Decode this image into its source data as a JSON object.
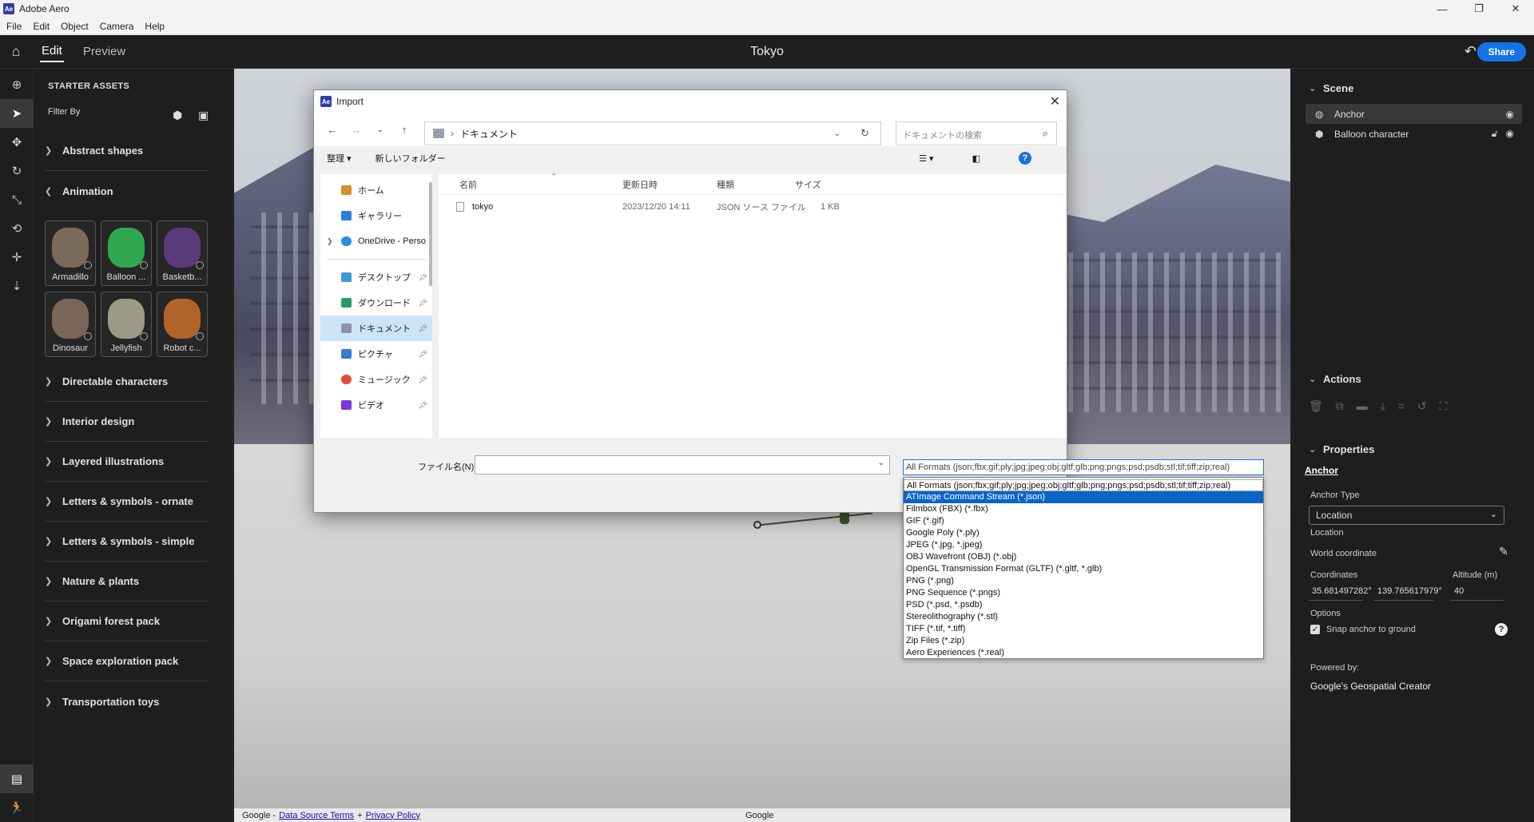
{
  "window": {
    "title": "Adobe Aero",
    "logo": "Ae",
    "controls": [
      "—",
      "❐",
      "✕"
    ]
  },
  "menu": [
    "File",
    "Edit",
    "Object",
    "Camera",
    "Help"
  ],
  "appbar": {
    "tabs": [
      "Edit",
      "Preview"
    ],
    "project_title": "Tokyo",
    "share_label": "Share"
  },
  "assets": {
    "header": "STARTER ASSETS",
    "filter_label": "Filter By",
    "categories_top": [
      "Abstract shapes",
      "Animation"
    ],
    "thumbnails": [
      {
        "label": "Armadillo",
        "color": "#7a6a5a"
      },
      {
        "label": "Balloon ...",
        "color": "#2fa84f"
      },
      {
        "label": "Basketb...",
        "color": "#5a3a7a"
      },
      {
        "label": "Dinosaur",
        "color": "#7a6658"
      },
      {
        "label": "Jellyfish",
        "color": "#9a9a86"
      },
      {
        "label": "Robot c...",
        "color": "#b0642a"
      }
    ],
    "categories": [
      "Directable characters",
      "Interior design",
      "Layered illustrations",
      "Letters & symbols - ornate",
      "Letters & symbols - simple",
      "Nature & plants",
      "Origami forest pack",
      "Space exploration pack",
      "Transportation toys"
    ]
  },
  "viewport": {
    "footer_prefix": "Google -",
    "footer_link1": "Data Source Terms",
    "footer_plus": "+",
    "footer_link2": "Privacy Policy",
    "footer_center": "Google"
  },
  "scene": {
    "title": "Scene",
    "items": [
      {
        "label": "Anchor",
        "selected": true
      },
      {
        "label": "Balloon character",
        "selected": false
      }
    ]
  },
  "actions": {
    "title": "Actions"
  },
  "properties": {
    "title": "Properties",
    "subtab": "Anchor",
    "anchor_type_label": "Anchor Type",
    "anchor_type_value": "Location",
    "location_label": "Location",
    "world_coord_label": "World coordinate",
    "coordinates_label": "Coordinates",
    "altitude_label": "Altitude (m)",
    "lat": "35.681497282°",
    "lng": "139.765617979°",
    "altitude": "40",
    "options_label": "Options",
    "snap_label": "Snap anchor to ground",
    "powered_by": "Powered by:",
    "provider": "Google's Geospatial Creator"
  },
  "dialog": {
    "title": "Import",
    "logo": "Ae",
    "path": "ドキュメント",
    "search_placeholder": "ドキュメントの検索",
    "organize": "整理 ▾",
    "new_folder": "新しいフォルダー",
    "nav": [
      {
        "label": "ホーム",
        "color": "#d98c2a",
        "pinned": false
      },
      {
        "label": "ギャラリー",
        "color": "#2a7fd9",
        "pinned": false
      },
      {
        "label": "OneDrive - Perso",
        "color": "#2a8be0",
        "pinned": false,
        "expandable": true
      },
      {
        "label": "デスクトップ",
        "color": "#3a9ad9",
        "pinned": true
      },
      {
        "label": "ダウンロード",
        "color": "#2a9a6a",
        "pinned": true
      },
      {
        "label": "ドキュメント",
        "color": "#8a93a8",
        "pinned": true,
        "selected": true
      },
      {
        "label": "ピクチャ",
        "color": "#3a7ad9",
        "pinned": true
      },
      {
        "label": "ミュージック",
        "color": "#d9503a",
        "pinned": true
      },
      {
        "label": "ビデオ",
        "color": "#7a3ad9",
        "pinned": true
      }
    ],
    "columns": [
      "名前",
      "更新日時",
      "種類",
      "サイズ"
    ],
    "files": [
      {
        "name": "tokyo",
        "modified": "2023/12/20 14:11",
        "type": "JSON ソース ファイル",
        "size": "1 KB"
      }
    ],
    "filename_label": "ファイル名(N):",
    "filetype_current": "All Formats (json;fbx;gif;ply;jpg;jpeg;obj;gltf;glb;png;pngs;psd;psdb;stl;tif;tiff;zip;real)",
    "filetype_options": [
      "All Formats (json;fbx;gif;ply;jpg;jpeg;obj;gltf;glb;png;pngs;psd;psdb;stl;tif;tiff;zip;real)",
      "ATImage Command Stream (*.json)",
      "Filmbox (FBX) (*.fbx)",
      "GIF (*.gif)",
      "Google Poly (*.ply)",
      "JPEG (*.jpg, *.jpeg)",
      "OBJ Wavefront (OBJ) (*.obj)",
      "OpenGL Transmission Format (GLTF) (*.gltf, *.glb)",
      "PNG (*.png)",
      "PNG Sequence (*.pngs)",
      "PSD (*.psd, *.psdb)",
      "Stereolithography (*.stl)",
      "TIFF (*.tif, *.tiff)",
      "Zip Files (*.zip)",
      "Aero Experiences (*.real)"
    ],
    "selected_option_index": 1
  }
}
